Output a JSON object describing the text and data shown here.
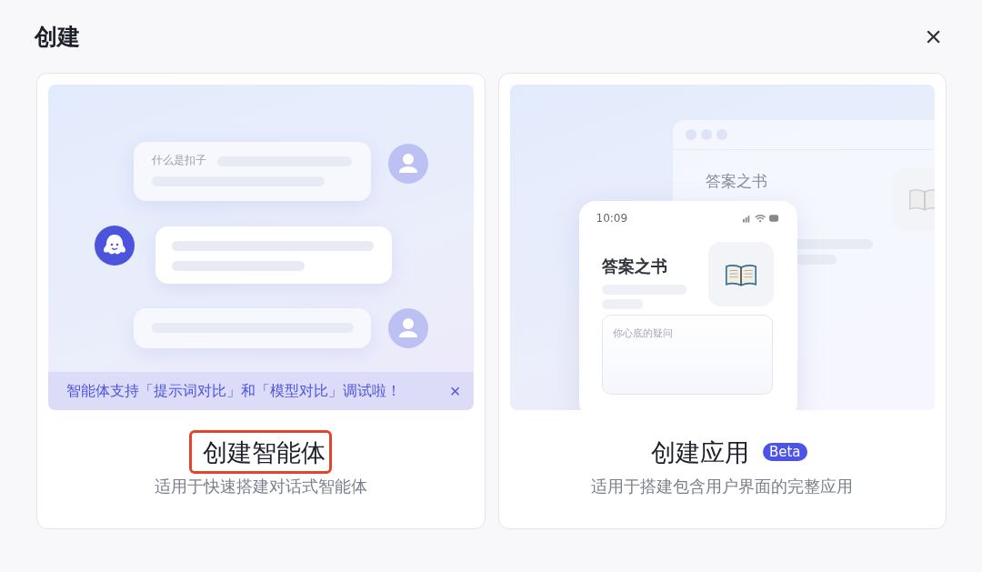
{
  "dialog": {
    "title": "创建",
    "close": "×"
  },
  "cards": [
    {
      "kind": "agent",
      "title": "创建智能体",
      "description": "适用于快速搭建对话式智能体",
      "highlighted": true,
      "illustration": {
        "question": "什么是扣子",
        "banner": {
          "text": "智能体支持「提示词对比」和「模型对比」调试啦！",
          "close": "×"
        }
      }
    },
    {
      "kind": "app",
      "title": "创建应用",
      "badge": "Beta",
      "description": "适用于搭建包含用户界面的完整应用",
      "highlighted": false,
      "illustration": {
        "back_title": "答案之书",
        "time": "10:09",
        "app_title": "答案之书",
        "placeholder": "你心底的疑问"
      }
    }
  ]
}
